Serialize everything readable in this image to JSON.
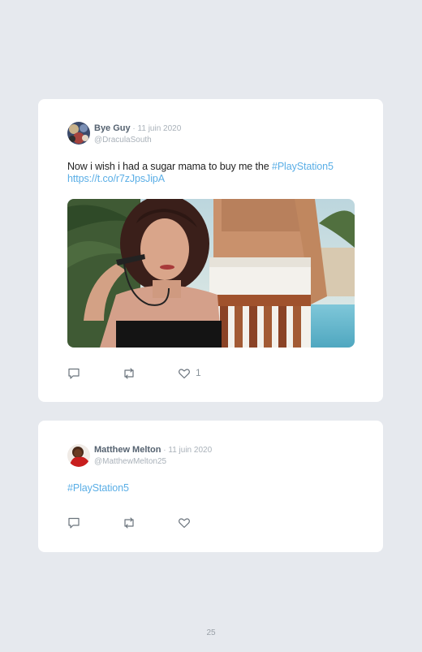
{
  "tweets": [
    {
      "name": "Bye Guy",
      "date_sep": " · ",
      "date": "11 juin 2020",
      "handle": "@DraculaSouth",
      "text_plain": "Now i wish i had a sugar mama to buy me the ",
      "hashtag": "#PlayStation5",
      "url": "https://t.co/r7zJpsJipA",
      "likes": "1",
      "media_icon": "photo-woman-with-sunglasses-and-shirtless-man"
    },
    {
      "name": "Matthew Melton",
      "date_sep": " · ",
      "date": "11 juin 2020",
      "handle": "@MatthewMelton25",
      "hashtag": "#PlayStation5"
    }
  ],
  "page_number": "25",
  "colors": {
    "background": "#e6e9ee",
    "card": "#ffffff",
    "link": "#5aaee6",
    "name": "#556270",
    "muted": "#a9b1b9"
  },
  "icons": [
    "reply-icon",
    "retweet-icon",
    "like-icon"
  ]
}
